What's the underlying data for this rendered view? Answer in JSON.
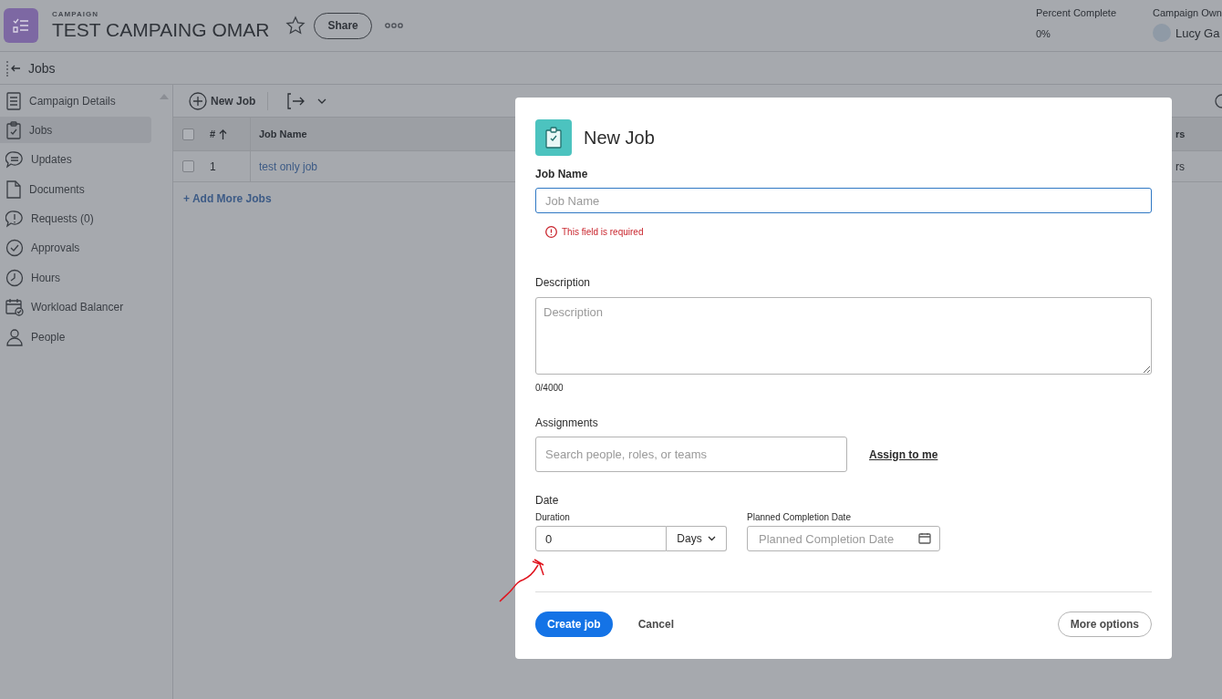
{
  "header": {
    "section_label": "CAMPAIGN",
    "title": "TEST CAMPAING OMAR",
    "share_button": "Share",
    "stats": [
      {
        "label": "Percent Complete",
        "value": "0%"
      }
    ],
    "owner": {
      "label": "Campaign Own",
      "name": "Lucy Ga"
    }
  },
  "breadcrumb": {
    "label": "Jobs"
  },
  "sidebar": {
    "items": [
      {
        "label": "Campaign Details",
        "selected": false
      },
      {
        "label": "Jobs",
        "selected": true
      },
      {
        "label": "Updates",
        "selected": false
      },
      {
        "label": "Documents",
        "selected": false
      },
      {
        "label": "Requests (0)",
        "selected": false
      },
      {
        "label": "Approvals",
        "selected": false
      },
      {
        "label": "Hours",
        "selected": false
      },
      {
        "label": "Workload Balancer",
        "selected": false
      },
      {
        "label": "People",
        "selected": false
      }
    ]
  },
  "toolbar": {
    "new_job_button": "New Job"
  },
  "table": {
    "columns": [
      "#",
      "Job Name",
      "rs"
    ],
    "header_checked": false,
    "rows": [
      {
        "checked": false,
        "number": "1",
        "job_name": "test only job",
        "column_3": "rs"
      }
    ],
    "add_link": "+ Add More Jobs"
  },
  "modal": {
    "title": "New Job",
    "job_name": {
      "label": "Job Name",
      "placeholder": "Job Name",
      "error": "This field is required"
    },
    "description": {
      "label": "Description",
      "placeholder": "Description",
      "counter": "0/4000"
    },
    "assignments": {
      "label": "Assignments",
      "placeholder": "Search people, roles, or teams",
      "link": "Assign to me"
    },
    "date": {
      "label": "Date",
      "duration": {
        "label": "Duration",
        "value": "0",
        "unit": "Days"
      },
      "planned": {
        "label": "Planned Completion Date",
        "placeholder": "Planned Completion Date"
      }
    },
    "buttons": {
      "primary": "Create job",
      "cancel": "Cancel",
      "more": "More options"
    }
  }
}
